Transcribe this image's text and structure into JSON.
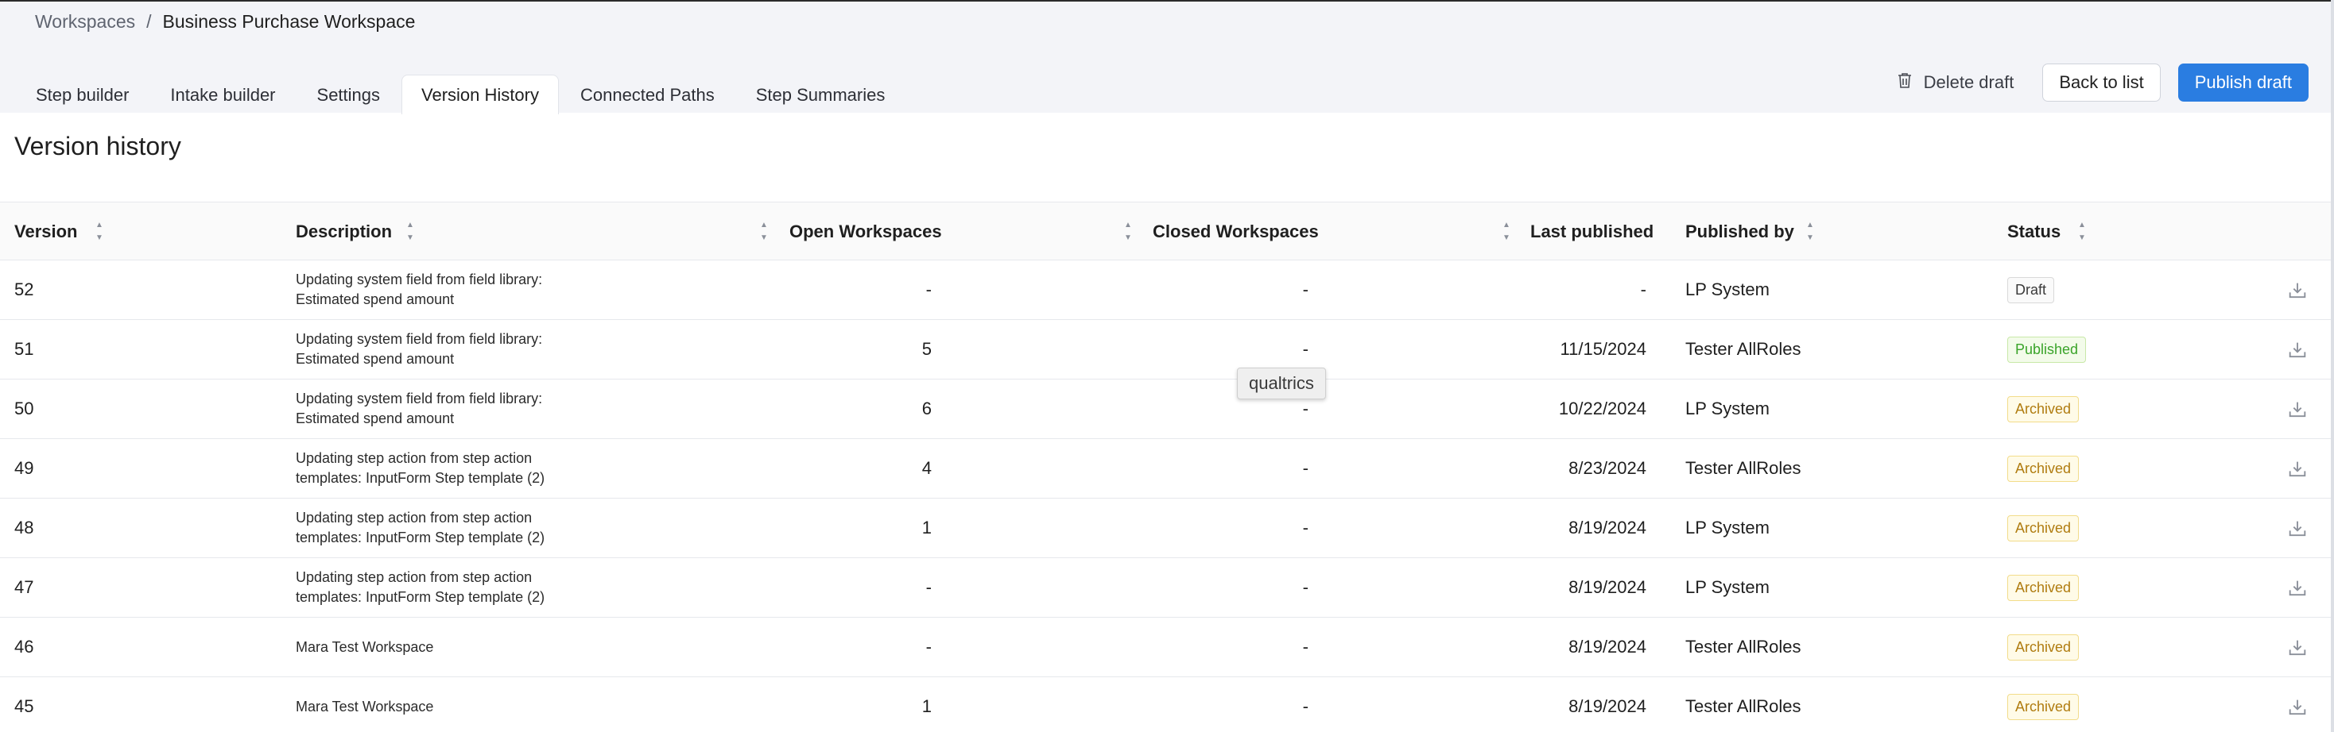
{
  "breadcrumb": {
    "parent": "Workspaces",
    "separator": "/",
    "current": "Business Purchase Workspace"
  },
  "tabs": [
    {
      "label": "Step builder"
    },
    {
      "label": "Intake builder"
    },
    {
      "label": "Settings"
    },
    {
      "label": "Version History",
      "active": true
    },
    {
      "label": "Connected Paths"
    },
    {
      "label": "Step Summaries"
    }
  ],
  "actions": {
    "delete_label": "Delete draft",
    "back_label": "Back to list",
    "publish_label": "Publish draft"
  },
  "page_title": "Version history",
  "table": {
    "headers": {
      "version": "Version",
      "description": "Description",
      "open": "Open Workspaces",
      "closed": "Closed Workspaces",
      "last_published": "Last published",
      "published_by": "Published by",
      "status": "Status"
    },
    "rows": [
      {
        "version": "52",
        "desc1": "Updating system field from field library:",
        "desc2": "Estimated spend amount",
        "open": "-",
        "closed": "-",
        "last_published": "-",
        "published_by": "LP System",
        "status": "Draft",
        "status_type": "draft"
      },
      {
        "version": "51",
        "desc1": "Updating system field from field library:",
        "desc2": "Estimated spend amount",
        "open": "5",
        "closed": "-",
        "last_published": "11/15/2024",
        "published_by": "Tester AllRoles",
        "status": "Published",
        "status_type": "published"
      },
      {
        "version": "50",
        "desc1": "Updating system field from field library:",
        "desc2": "Estimated spend amount",
        "open": "6",
        "closed": "-",
        "last_published": "10/22/2024",
        "published_by": "LP System",
        "status": "Archived",
        "status_type": "archived"
      },
      {
        "version": "49",
        "desc1": "Updating step action from step action",
        "desc2": "templates: InputForm Step template (2)",
        "open": "4",
        "closed": "-",
        "last_published": "8/23/2024",
        "published_by": "Tester AllRoles",
        "status": "Archived",
        "status_type": "archived"
      },
      {
        "version": "48",
        "desc1": "Updating step action from step action",
        "desc2": "templates: InputForm Step template (2)",
        "open": "1",
        "closed": "-",
        "last_published": "8/19/2024",
        "published_by": "LP System",
        "status": "Archived",
        "status_type": "archived"
      },
      {
        "version": "47",
        "desc1": "Updating step action from step action",
        "desc2": "templates: InputForm Step template (2)",
        "open": "-",
        "closed": "-",
        "last_published": "8/19/2024",
        "published_by": "LP System",
        "status": "Archived",
        "status_type": "archived"
      },
      {
        "version": "46",
        "desc1": "Mara Test Workspace",
        "desc2": "",
        "open": "-",
        "closed": "-",
        "last_published": "8/19/2024",
        "published_by": "Tester AllRoles",
        "status": "Archived",
        "status_type": "archived"
      },
      {
        "version": "45",
        "desc1": "Mara Test Workspace",
        "desc2": "",
        "open": "1",
        "closed": "-",
        "last_published": "8/19/2024",
        "published_by": "Tester AllRoles",
        "status": "Archived",
        "status_type": "archived"
      }
    ]
  },
  "tooltip": "qualtrics",
  "icons": {
    "delete": "trash-icon",
    "download": "download-icon",
    "sort": "sort-icon"
  }
}
